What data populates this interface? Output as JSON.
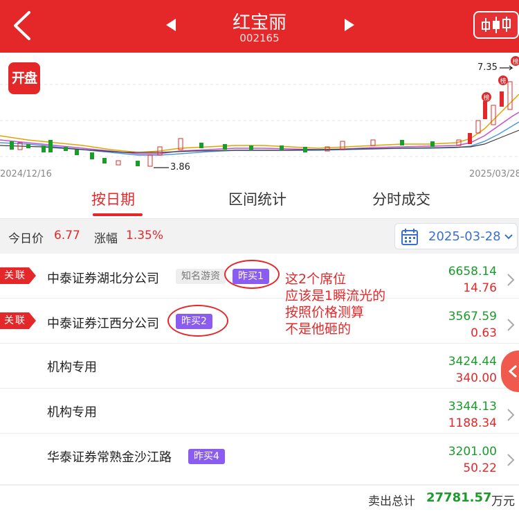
{
  "header": {
    "title": "红宝丽",
    "code": "002165"
  },
  "chart": {
    "badge": "开盘",
    "start_date": "2024/12/16",
    "end_date": "2025/03/28",
    "low_label": "3.86",
    "high_label": "7.35",
    "limit_tag": "榜"
  },
  "tabs": [
    {
      "label": "按日期"
    },
    {
      "label": "区间统计"
    },
    {
      "label": "分时成交"
    }
  ],
  "pricebar": {
    "price_label": "今日价",
    "price_value": "6.77",
    "change_label": "涨幅",
    "change_value": "1.35%",
    "date": "2025-03-28"
  },
  "rows": [
    {
      "tag": "关联",
      "name": "中泰证券湖北分公司",
      "badge_grey": "知名游资",
      "badge": "昨买1",
      "buy": "6658.14",
      "sell": "14.76"
    },
    {
      "tag": "关联",
      "name": "中泰证券江西分公司",
      "badge": "昨买2",
      "buy": "3567.59",
      "sell": "0.63"
    },
    {
      "name": "机构专用",
      "buy": "3424.44",
      "sell": "340.00"
    },
    {
      "name": "机构专用",
      "buy": "3344.13",
      "sell": "1188.34"
    },
    {
      "name": "华泰证券常熟金沙江路",
      "badge": "昨买4",
      "buy": "3201.00",
      "sell": "50.22"
    }
  ],
  "annotation": [
    "这2个席位",
    "应该是1瞬流光的",
    "按照价格测算",
    "不是他砸的"
  ],
  "total": {
    "label": "卖出总计",
    "value": "27781.57",
    "unit": "万元"
  },
  "colors": {
    "brand_red": "#e4282a",
    "up_red": "#e4282a",
    "down_green": "#1a9b2a",
    "badge_purple": "#8a5cf0",
    "date_blue": "#3a6fd0"
  }
}
